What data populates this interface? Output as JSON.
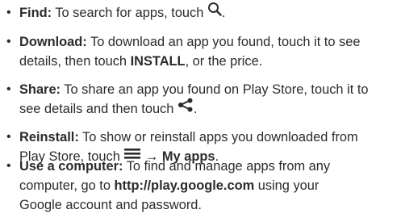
{
  "items": [
    {
      "term": "Find:",
      "text": " To search for apps, touch ",
      "icon": "search-icon",
      "end": "."
    },
    {
      "term": "Download:",
      "line1": " To download an app you found, touch it to see",
      "line2_pre": "details, then touch ",
      "line2_strong": "INSTALL",
      "line2_post": ", or the price."
    },
    {
      "term": "Share:",
      "line1": " To share an app you found on Play Store, touch it to",
      "line2_pre": "see details and then touch ",
      "icon": "share-icon",
      "end": "."
    },
    {
      "term": "Reinstall:",
      "line1": " To show or reinstall apps you downloaded from",
      "line2_pre": "Play Store, touch ",
      "icon": "menu-icon",
      "arrow": "→",
      "line2_strong": "My apps",
      "end": "."
    },
    {
      "term": "Use a computer:",
      "line1": " To find and manage apps from any",
      "line2_pre": "computer, go to ",
      "line2_strong": "http://play.google.com",
      "line2_post": " using your",
      "line3": "Google account and password."
    }
  ],
  "bullet_char": "•"
}
